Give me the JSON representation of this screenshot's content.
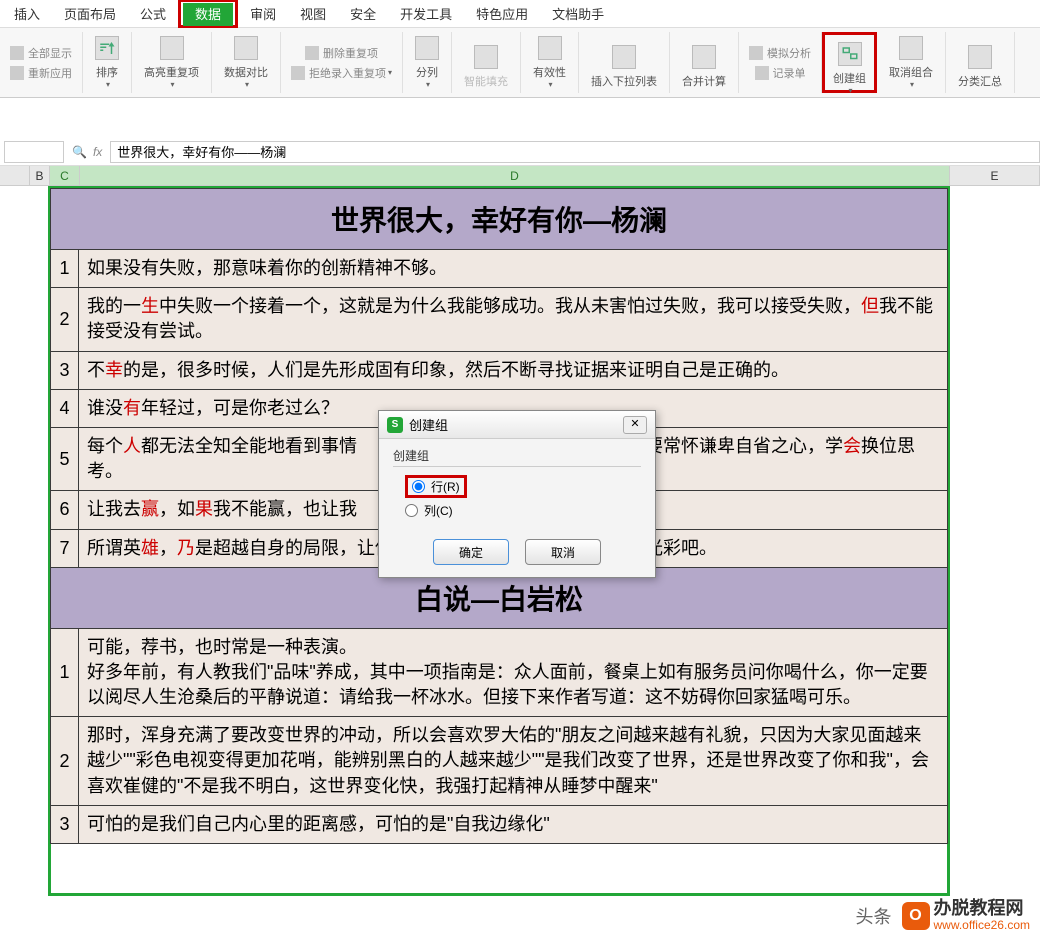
{
  "menu": {
    "items": [
      "插入",
      "页面布局",
      "公式",
      "数据",
      "审阅",
      "视图",
      "安全",
      "开发工具",
      "特色应用",
      "文档助手"
    ],
    "active_index": 3
  },
  "ribbon": {
    "show_all": "全部显示",
    "reapply": "重新应用",
    "sort": "排序",
    "highlight_dup": "高亮重复项",
    "data_compare": "数据对比",
    "remove_dup": "删除重复项",
    "reject_dup": "拒绝录入重复项",
    "split": "分列",
    "smart_fill": "智能填充",
    "validation": "有效性",
    "insert_dropdown": "插入下拉列表",
    "consolidate": "合并计算",
    "record_form": "记录单",
    "what_if": "模拟分析",
    "create_group": "创建组",
    "ungroup": "取消组合",
    "subtotal": "分类汇总"
  },
  "formula_bar": {
    "fx": "fx",
    "value": "世界很大，幸好有你——杨澜"
  },
  "columns": [
    "B",
    "C",
    "D",
    "E"
  ],
  "table": {
    "title1": "世界很大，幸好有你—杨澜",
    "title2": "白说—白岩松",
    "rows1": [
      {
        "n": "1",
        "text": "如果没有失败，那意味着你的创新精神不够。"
      },
      {
        "n": "2",
        "text_parts": [
          {
            "t": "我的一",
            "r": false
          },
          {
            "t": "生",
            "r": true
          },
          {
            "t": "中失败一个接着一个，这就是为什么我能够成功。我从未害怕过失败，我可以接受失败，",
            "r": false
          },
          {
            "t": "但",
            "r": true
          },
          {
            "t": "我不能接受没有尝试。",
            "r": false
          }
        ]
      },
      {
        "n": "3",
        "text_parts": [
          {
            "t": "不",
            "r": false
          },
          {
            "t": "幸",
            "r": true
          },
          {
            "t": "的是，很多时候，人们是先形成固有印象，然后不断寻找证据来证明自己是正确的。",
            "r": false
          }
        ]
      },
      {
        "n": "4",
        "text_parts": [
          {
            "t": "谁没",
            "r": false
          },
          {
            "t": "有",
            "r": true
          },
          {
            "t": "年轻过，可是你老过么？",
            "r": false
          }
        ]
      },
      {
        "n": "5",
        "text_parts": [
          {
            "t": "每个",
            "r": false
          },
          {
            "t": "人",
            "r": true
          },
          {
            "t": "都无法全知全能地看到事情",
            "r": false
          },
          {
            "t": "　　　　　　　　　　　　　",
            "r": false
          },
          {
            "t": "，所以要常怀谦卑自省之心，学",
            "r": false
          },
          {
            "t": "会",
            "r": true
          },
          {
            "t": "换位思考。",
            "r": false
          }
        ]
      },
      {
        "n": "6",
        "text_parts": [
          {
            "t": "让我去",
            "r": false
          },
          {
            "t": "赢",
            "r": true
          },
          {
            "t": "，如",
            "r": false
          },
          {
            "t": "果",
            "r": true
          },
          {
            "t": "我不能赢，也让我",
            "r": false
          }
        ]
      },
      {
        "n": "7",
        "text_parts": [
          {
            "t": "所谓英",
            "r": false
          },
          {
            "t": "雄",
            "r": true
          },
          {
            "t": "，",
            "r": false
          },
          {
            "t": "乃",
            "r": true
          },
          {
            "t": "是超越自身的局限，让他人因你的存在而焕发出生命的的光彩吧。",
            "r": false
          }
        ]
      }
    ],
    "rows2": [
      {
        "n": "1",
        "text": "可能，荐书，也时常是一种表演。\n好多年前，有人教我们\"品味\"养成，其中一项指南是：众人面前，餐桌上如有服务员问你喝什么，你一定要以阅尽人生沧桑后的平静说道：请给我一杯冰水。但接下来作者写道：这不妨碍你回家猛喝可乐。"
      },
      {
        "n": "2",
        "text": "那时，浑身充满了要改变世界的冲动，所以会喜欢罗大佑的\"朋友之间越来越有礼貌，只因为大家见面越来越少\"\"彩色电视变得更加花哨，能辨别黑白的人越来越少\"\"是我们改变了世界，还是世界改变了你和我\"，会喜欢崔健的\"不是我不明白，这世界变化快，我强打起精神从睡梦中醒来\""
      },
      {
        "n": "3",
        "text": "可怕的是我们自己内心里的距离感，可怕的是\"自我边缘化\""
      }
    ]
  },
  "dialog": {
    "title": "创建组",
    "section": "创建组",
    "row_option": "行(R)",
    "col_option": "列(C)",
    "ok": "确定",
    "cancel": "取消"
  },
  "watermark": {
    "line1": "办脱教程网",
    "line2": "www.office26.com",
    "toutiao": "头条"
  }
}
